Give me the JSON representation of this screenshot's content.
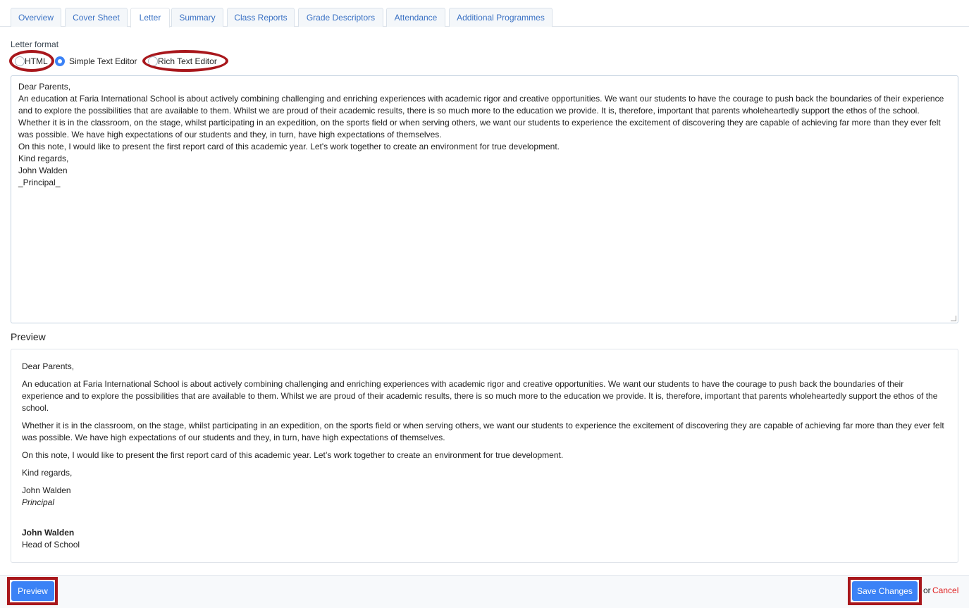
{
  "tabs": [
    {
      "label": "Overview"
    },
    {
      "label": "Cover Sheet"
    },
    {
      "label": "Letter",
      "active": true
    },
    {
      "label": "Summary"
    },
    {
      "label": "Class Reports"
    },
    {
      "label": "Grade Descriptors"
    },
    {
      "label": "Attendance"
    },
    {
      "label": "Additional Programmes"
    }
  ],
  "letter_format": {
    "label": "Letter format",
    "options": [
      {
        "label": "HTML",
        "checked": false
      },
      {
        "label": "Simple Text Editor",
        "checked": true
      },
      {
        "label": "Rich Text Editor",
        "checked": false
      }
    ]
  },
  "editor": {
    "lines": [
      "Dear Parents,",
      "",
      "An education at Faria International School is about actively combining challenging and enriching experiences with academic rigor and creative opportunities. We want our students to have the courage to push back the boundaries of their experience and to explore the possibilities that are available to them. Whilst we are proud of their academic results, there is so much more to the education we provide. It is, therefore, important that parents wholeheartedly support the ethos of the school.",
      "",
      "Whether it is in the classroom, on the stage, whilst participating in an expedition, on the sports field or when serving others, we want our students to experience the excitement of discovering they are capable of achieving far more than they ever felt was possible. We have high expectations of our students and they, in turn, have high expectations of themselves.",
      "",
      "On this note, I would like to present the first report card of this academic year. Let's work together to create an environment for true development.",
      "",
      "",
      "Kind regards,",
      "",
      "John Walden",
      "_Principal_"
    ]
  },
  "preview": {
    "heading": "Preview",
    "greeting": "Dear Parents,",
    "paragraphs": [
      "An education at Faria International School is about actively combining challenging and enriching experiences with academic rigor and creative opportunities. We want our students to have the courage to push back the boundaries of their experience and to explore the possibilities that are available to them. Whilst we are proud of their academic results, there is so much more to the education we provide. It is, therefore, important that parents wholeheartedly support the ethos of the school.",
      "Whether it is in the classroom, on the stage, whilst participating in an expedition, on the sports field or when serving others, we want our students to experience the excitement of discovering they are capable of achieving far more than they ever felt was possible. We have high expectations of our students and they, in turn, have high expectations of themselves.",
      "On this note, I would like to present the first report card of this academic year. Let’s work together to create an environment for true development."
    ],
    "closing": "Kind regards,",
    "signer_name": "John Walden",
    "signer_title": "Principal",
    "signature_name": "John Walden",
    "signature_role": "Head of School"
  },
  "footer": {
    "preview_label": "Preview",
    "save_label": "Save Changes",
    "or_text": "or",
    "cancel_label": "Cancel"
  },
  "colors": {
    "accent": "#3b82f6",
    "highlight": "#a8171c",
    "cancel": "#e02424",
    "tab_text": "#3b72c4"
  }
}
